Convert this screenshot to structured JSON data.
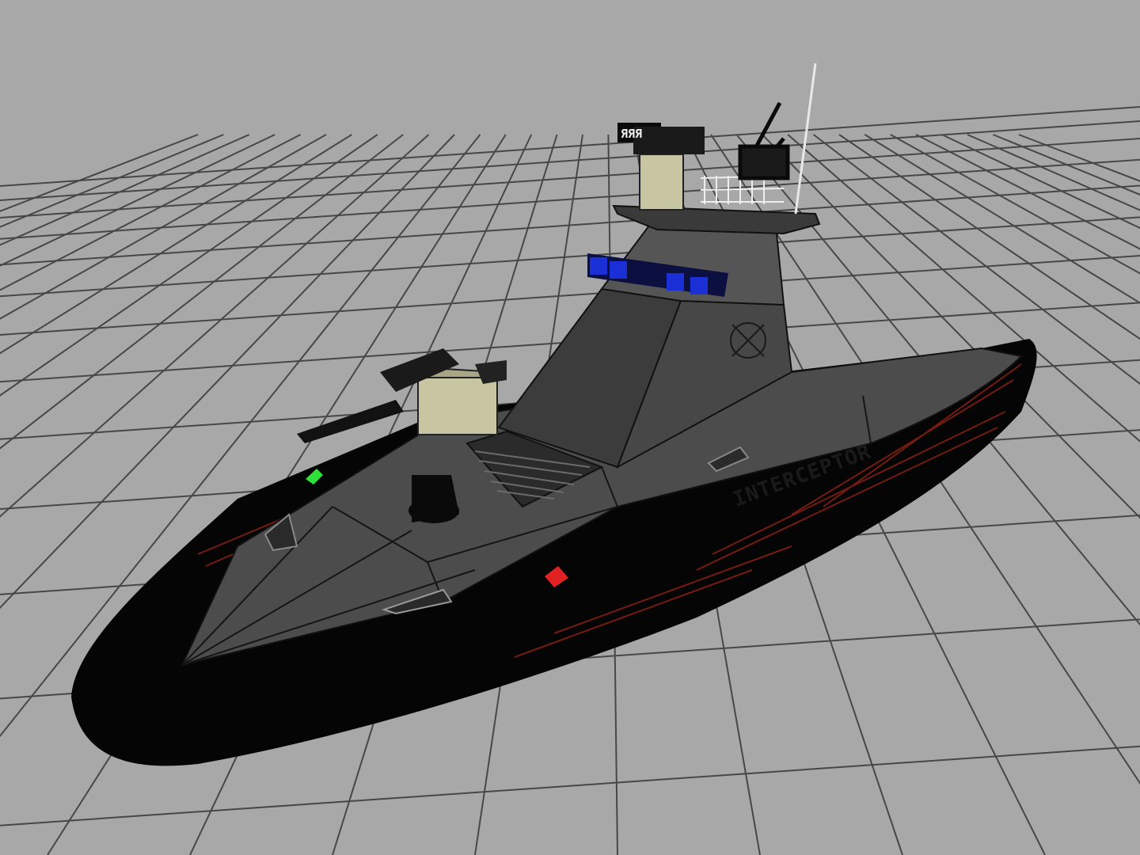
{
  "viewport": {
    "background_color": "#a8a8a8",
    "grid_color": "#4a4a4a",
    "grid_visible": true,
    "shading_mode": "wireframe-on-shaded"
  },
  "model": {
    "hull_name": "INTERCEPTOR",
    "turret_tag": "ЯЯЯ",
    "hull_color": "#050505",
    "deck_color": "#4c4c4c",
    "trim_color": "#b5281a",
    "light_bar_color": "#1a2fd6",
    "box_color": "#c8c6a2",
    "starboard_light_color": "#2ee23a",
    "port_light_color": "#e22222"
  }
}
